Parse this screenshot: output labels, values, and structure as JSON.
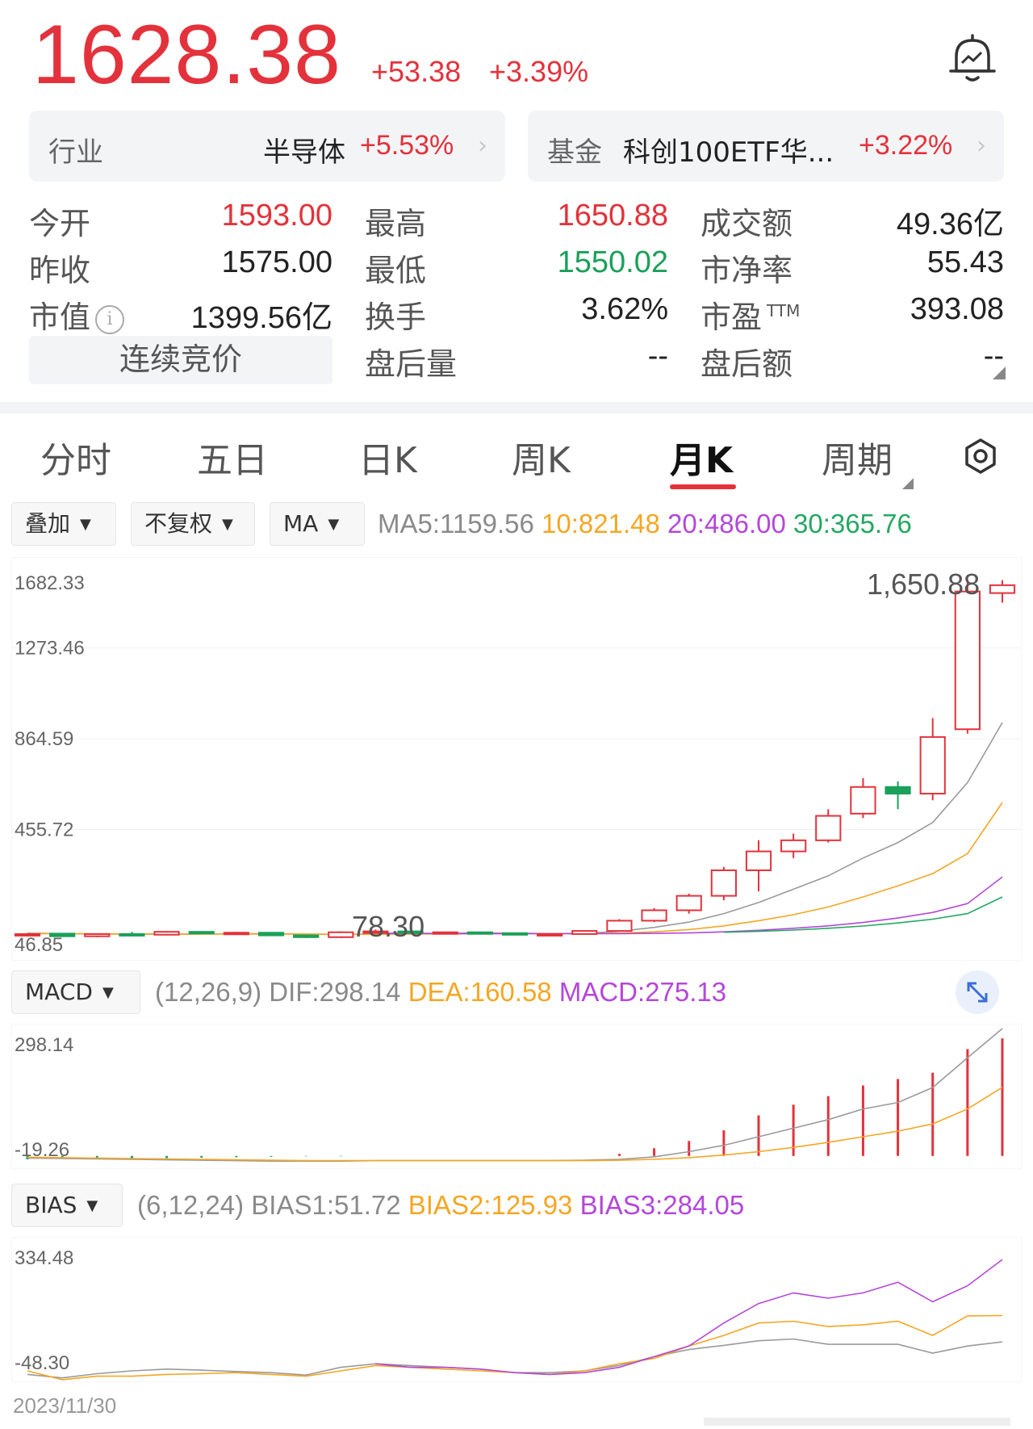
{
  "quote": {
    "price": "1628.38",
    "change": "+53.38",
    "change_pct": "+3.39%"
  },
  "industry": {
    "label": "行业",
    "name": "半导体",
    "change_pct": "+5.53%"
  },
  "fund": {
    "label": "基金",
    "name": "科创100ETF华...",
    "change_pct": "+3.22%"
  },
  "stats": [
    {
      "label": "今开",
      "value": "1593.00",
      "color": "red"
    },
    {
      "label": "最高",
      "value": "1650.88",
      "color": "red"
    },
    {
      "label": "成交额",
      "value": "49.36亿",
      "color": "black"
    },
    {
      "label": "昨收",
      "value": "1575.00",
      "color": "black"
    },
    {
      "label": "最低",
      "value": "1550.02",
      "color": "green"
    },
    {
      "label": "市净率",
      "value": "55.43",
      "color": "black"
    },
    {
      "label": "市值",
      "value": "1399.56亿",
      "color": "black"
    },
    {
      "label": "换手",
      "value": "3.62%",
      "color": "black"
    },
    {
      "label": "市盈",
      "sup": "TTM",
      "value": "393.08",
      "color": "black"
    },
    {
      "label": "盘后量",
      "value": "--",
      "color": "black"
    },
    {
      "label": "盘后额",
      "value": "--",
      "color": "black"
    }
  ],
  "auction_label": "连续竞价",
  "tabs": [
    "分时",
    "五日",
    "日K",
    "周K",
    "月K",
    "周期"
  ],
  "active_tab": "月K",
  "controls": {
    "overlay": "叠加",
    "adjust": "不复权",
    "indicator": "MA"
  },
  "ma_legend": {
    "ma5": "MA5:1159.56",
    "ma10": "10:821.48",
    "ma20": "20:486.00",
    "ma30": "30:365.76"
  },
  "macd": {
    "label": "MACD",
    "params": "(12,26,9)",
    "dif": "DIF:298.14",
    "dea": "DEA:160.58",
    "macd": "MACD:275.13"
  },
  "bias": {
    "label": "BIAS",
    "params": "(6,12,24)",
    "bias1": "BIAS1:51.72",
    "bias2": "BIAS2:125.93",
    "bias3": "BIAS3:284.05"
  },
  "date_label": "2023/11/30",
  "colors": {
    "up": "#e3323b",
    "down": "#1aa05a",
    "ma5": "#9a9a9a",
    "ma10": "#f5a623",
    "ma20": "#b447d9",
    "ma30": "#24a861"
  },
  "chart_data": [
    {
      "type": "candlestick",
      "title": "",
      "ylim": [
        46.85,
        1682.33
      ],
      "y_ticks": [
        "1682.33",
        "1273.46",
        "864.59",
        "455.72",
        "46.85"
      ],
      "annotations": [
        "1,650.88",
        "78.30"
      ],
      "candles": [
        {
          "o": 55,
          "h": 62,
          "l": 50,
          "c": 58
        },
        {
          "o": 60,
          "h": 62,
          "l": 46.85,
          "c": 48
        },
        {
          "o": 48,
          "h": 60,
          "l": 44,
          "c": 58
        },
        {
          "o": 58,
          "h": 68,
          "l": 52,
          "c": 55
        },
        {
          "o": 55,
          "h": 72,
          "l": 52,
          "c": 68
        },
        {
          "o": 68,
          "h": 70,
          "l": 60,
          "c": 62
        },
        {
          "o": 62,
          "h": 68,
          "l": 58,
          "c": 64
        },
        {
          "o": 64,
          "h": 66,
          "l": 50,
          "c": 52
        },
        {
          "o": 52,
          "h": 56,
          "l": 40,
          "c": 44
        },
        {
          "o": 44,
          "h": 70,
          "l": 40,
          "c": 66
        },
        {
          "o": 66,
          "h": 78.3,
          "l": 62,
          "c": 70
        },
        {
          "o": 70,
          "h": 72,
          "l": 64,
          "c": 68
        },
        {
          "o": 64,
          "h": 68,
          "l": 58,
          "c": 66
        },
        {
          "o": 66,
          "h": 68,
          "l": 60,
          "c": 62
        },
        {
          "o": 62,
          "h": 64,
          "l": 54,
          "c": 56
        },
        {
          "o": 56,
          "h": 60,
          "l": 48,
          "c": 58
        },
        {
          "o": 58,
          "h": 74,
          "l": 56,
          "c": 72
        },
        {
          "o": 72,
          "h": 125,
          "l": 70,
          "c": 118
        },
        {
          "o": 118,
          "h": 175,
          "l": 112,
          "c": 165
        },
        {
          "o": 165,
          "h": 240,
          "l": 150,
          "c": 230
        },
        {
          "o": 230,
          "h": 360,
          "l": 210,
          "c": 345
        },
        {
          "o": 345,
          "h": 480,
          "l": 250,
          "c": 430
        },
        {
          "o": 430,
          "h": 510,
          "l": 400,
          "c": 480
        },
        {
          "o": 480,
          "h": 620,
          "l": 470,
          "c": 590
        },
        {
          "o": 600,
          "h": 760,
          "l": 580,
          "c": 720
        },
        {
          "o": 720,
          "h": 745,
          "l": 620,
          "c": 690
        },
        {
          "o": 690,
          "h": 1030,
          "l": 660,
          "c": 945
        },
        {
          "o": 980,
          "h": 1650.88,
          "l": 960,
          "c": 1600
        },
        {
          "o": 1593,
          "h": 1650.88,
          "l": 1550.02,
          "c": 1628.38
        }
      ],
      "series": [
        {
          "name": "MA5",
          "values": [
            62,
            60,
            58,
            58,
            57,
            58,
            59,
            60,
            57,
            56,
            58,
            60,
            62,
            63,
            62,
            60,
            61,
            70,
            88,
            112,
            150,
            200,
            260,
            320,
            400,
            470,
            560,
            740,
            1010
          ]
        },
        {
          "name": "10",
          "values": [
            60,
            60,
            59,
            59,
            58,
            58,
            58,
            58,
            58,
            57,
            57,
            58,
            59,
            60,
            60,
            60,
            60,
            62,
            68,
            78,
            95,
            118,
            145,
            180,
            225,
            275,
            330,
            420,
            650
          ]
        },
        {
          "name": "20",
          "values": [
            null,
            null,
            null,
            null,
            null,
            null,
            null,
            null,
            null,
            null,
            62,
            61,
            60,
            60,
            60,
            60,
            60,
            60,
            61,
            63,
            68,
            75,
            84,
            95,
            110,
            130,
            155,
            195,
            315
          ]
        },
        {
          "name": "30",
          "values": [
            null,
            null,
            null,
            null,
            null,
            null,
            null,
            null,
            null,
            null,
            null,
            null,
            null,
            null,
            null,
            null,
            null,
            null,
            null,
            null,
            66,
            70,
            76,
            84,
            94,
            108,
            125,
            150,
            225
          ]
        }
      ]
    },
    {
      "type": "bar",
      "title": "MACD",
      "ylim": [
        -19.26,
        298.14
      ],
      "y_ticks": [
        "298.14",
        "-19.26"
      ],
      "values": [
        -8,
        -7,
        -6,
        -6,
        -5,
        -4,
        -3,
        -2,
        -1,
        -1,
        0,
        0,
        0,
        0,
        0,
        0,
        0,
        5,
        18,
        35,
        60,
        95,
        120,
        140,
        165,
        180,
        195,
        250,
        275.13
      ],
      "series": [
        {
          "name": "DIF",
          "values": [
            -5,
            -6,
            -7,
            -8,
            -9,
            -10,
            -11,
            -12,
            -12,
            -12,
            -11,
            -11,
            -11,
            -11,
            -11,
            -11,
            -10,
            -8,
            -2,
            10,
            25,
            45,
            65,
            85,
            110,
            125,
            160,
            230,
            298.14
          ]
        },
        {
          "name": "DEA",
          "values": [
            -3,
            -4,
            -5,
            -6,
            -7,
            -8,
            -9,
            -10,
            -11,
            -11,
            -11,
            -11,
            -11,
            -11,
            -11,
            -11,
            -11,
            -10,
            -8,
            -4,
            2,
            10,
            20,
            32,
            45,
            58,
            75,
            110,
            160.58
          ]
        }
      ]
    },
    {
      "type": "line",
      "title": "BIAS",
      "ylim": [
        -48.3,
        334.48
      ],
      "y_ticks": [
        "334.48",
        "-48.30"
      ],
      "series": [
        {
          "name": "BIAS1",
          "values": [
            -40,
            -50,
            -38,
            -30,
            -25,
            -28,
            -32,
            -35,
            -42,
            -20,
            -10,
            -15,
            -20,
            -25,
            -35,
            -35,
            -30,
            -15,
            10,
            30,
            42,
            55,
            60,
            45,
            45,
            45,
            20,
            40,
            51.72
          ]
        },
        {
          "name": "BIAS2",
          "values": [
            -30,
            -55,
            -45,
            -45,
            -40,
            -38,
            -35,
            -40,
            -45,
            -30,
            -15,
            -20,
            -25,
            -30,
            -35,
            -40,
            -30,
            -10,
            5,
            40,
            70,
            105,
            110,
            95,
            100,
            110,
            70,
            125,
            125.93
          ]
        },
        {
          "name": "BIAS3",
          "values": [
            null,
            null,
            null,
            null,
            null,
            null,
            null,
            null,
            null,
            null,
            -10,
            -20,
            -20,
            -25,
            -35,
            -40,
            -35,
            -20,
            10,
            40,
            105,
            160,
            190,
            175,
            190,
            220,
            165,
            210,
            284.05
          ]
        }
      ]
    }
  ]
}
